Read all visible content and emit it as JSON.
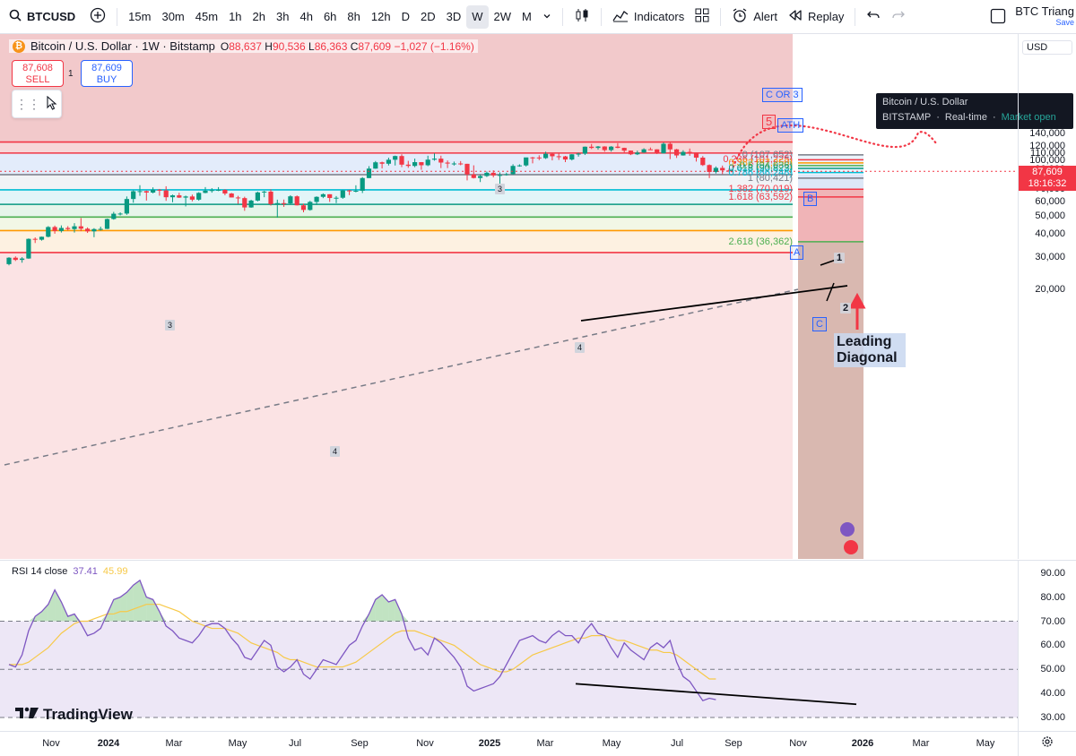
{
  "toolbar": {
    "symbol": "BTCUSD",
    "timeframes": [
      "15m",
      "30m",
      "45m",
      "1h",
      "2h",
      "3h",
      "4h",
      "6h",
      "8h",
      "12h",
      "D",
      "2D",
      "3D",
      "W",
      "2W",
      "M"
    ],
    "active_timeframe": "W",
    "indicators_label": "Indicators",
    "alert_label": "Alert",
    "replay_label": "Replay",
    "layout_name": "BTC Triang",
    "save_label": "Save"
  },
  "legend": {
    "title": "Bitcoin / U.S. Dollar · 1W · Bitstamp",
    "o_label": "O",
    "o": "88,637",
    "h_label": "H",
    "h": "90,536",
    "l_label": "L",
    "l": "86,363",
    "c_label": "C",
    "c": "87,609",
    "change": "−1,027 (−1.16%)"
  },
  "trade": {
    "sell_price": "87,608",
    "sell_label": "SELL",
    "buy_price": "87,609",
    "buy_label": "BUY",
    "spread": "1"
  },
  "tooltip": {
    "line1": "Bitcoin / U.S. Dollar",
    "exchange": "BITSTAMP",
    "session": "Real-time",
    "status": "Market open"
  },
  "price_axis": {
    "currency": "USD",
    "ticks": [
      "140,000",
      "120,000",
      "110,000",
      "100,000",
      "90,000",
      "80,000",
      "70,000",
      "60,000",
      "50,000",
      "40,000",
      "30,000",
      "20,000"
    ],
    "last_price": "87,609",
    "countdown": "18:16:32"
  },
  "rsi": {
    "label": "RSI 14 close",
    "value": "37.41",
    "ma_value": "45.99",
    "ticks": [
      "90.00",
      "80.00",
      "70.00",
      "60.00",
      "50.00",
      "40.00",
      "30.00"
    ]
  },
  "time_axis": {
    "labels": [
      "Nov",
      "2024",
      "Mar",
      "May",
      "Jul",
      "Sep",
      "Nov",
      "2025",
      "Mar",
      "May",
      "Jul",
      "Sep",
      "Nov",
      "2026",
      "Mar",
      "May"
    ]
  },
  "annotations": {
    "c_or_3": "C OR 3",
    "wave5": "5",
    "ath": "ATH",
    "b": "B",
    "a": "A",
    "c": "C",
    "w1": "1",
    "w2": "2",
    "w3_top": "3",
    "w3_left": "3",
    "w4_left": "4",
    "w4_mid": "4",
    "leading_line1": "Leading",
    "leading_line2": "Diagonal"
  },
  "fib_levels": [
    {
      "label": "0 (107,652)",
      "price": 107652,
      "color": "#787b86"
    },
    {
      "label": "0.236 (101,225)",
      "price": 101225,
      "color": "#f23645"
    },
    {
      "label": "0.382 (97,250)",
      "price": 97250,
      "color": "#ff9800"
    },
    {
      "label": "0.5 (94,036)",
      "price": 94036,
      "color": "#4caf50"
    },
    {
      "label": "0.618 (90,823)",
      "price": 90823,
      "color": "#089981"
    },
    {
      "label": "0.786 (86,248)",
      "price": 86248,
      "color": "#00bcd4"
    },
    {
      "label": "1 (80,421)",
      "price": 80421,
      "color": "#787b86"
    },
    {
      "label": "1.382 (70,019)",
      "price": 70019,
      "color": "#f23645"
    },
    {
      "label": "1.618 (63,592)",
      "price": 63592,
      "color": "#f23645"
    },
    {
      "label": "2.618 (36,362)",
      "price": 36362,
      "color": "#4caf50"
    }
  ],
  "horizontal_levels": [
    {
      "price": 126200,
      "color": "#f23645"
    },
    {
      "price": 110000,
      "color": "#f23645"
    },
    {
      "price": 84000,
      "color": "#787b86"
    },
    {
      "price": 69500,
      "color": "#00bcd4"
    },
    {
      "price": 58000,
      "color": "#089981"
    },
    {
      "price": 49500,
      "color": "#4caf50"
    },
    {
      "price": 41800,
      "color": "#ff9800"
    },
    {
      "price": 31800,
      "color": "#f23645"
    }
  ],
  "chart_data": {
    "type": "candlestick",
    "symbol": "Bitcoin / U.S. Dollar",
    "interval": "1W",
    "y_scale": "log",
    "ylim": [
      20000,
      145000
    ],
    "x": [
      "2023-10-23",
      "2023-10-30",
      "2023-11-06",
      "2023-11-13",
      "2023-11-20",
      "2023-11-27",
      "2023-12-04",
      "2023-12-11",
      "2023-12-18",
      "2023-12-25",
      "2024-01-01",
      "2024-01-08",
      "2024-01-15",
      "2024-01-22",
      "2024-01-29",
      "2024-02-05",
      "2024-02-12",
      "2024-02-19",
      "2024-02-26",
      "2024-03-04",
      "2024-03-11",
      "2024-03-18",
      "2024-03-25",
      "2024-04-01",
      "2024-04-08",
      "2024-04-15",
      "2024-04-22",
      "2024-04-29",
      "2024-05-06",
      "2024-05-13",
      "2024-05-20",
      "2024-05-27",
      "2024-06-03",
      "2024-06-10",
      "2024-06-17",
      "2024-06-24",
      "2024-07-01",
      "2024-07-08",
      "2024-07-15",
      "2024-07-22",
      "2024-07-29",
      "2024-08-05",
      "2024-08-12",
      "2024-08-19",
      "2024-08-26",
      "2024-09-02",
      "2024-09-09",
      "2024-09-16",
      "2024-09-23",
      "2024-09-30",
      "2024-10-07",
      "2024-10-14",
      "2024-10-21",
      "2024-10-28",
      "2024-11-04",
      "2024-11-11",
      "2024-11-18",
      "2024-11-25",
      "2024-12-02",
      "2024-12-09",
      "2024-12-16",
      "2024-12-23",
      "2024-12-30",
      "2025-01-06",
      "2025-01-13",
      "2025-01-20",
      "2025-01-27",
      "2025-02-03",
      "2025-02-10",
      "2025-02-17",
      "2025-02-24",
      "2025-03-03",
      "2025-03-10",
      "2025-03-17",
      "2025-03-24",
      "2025-03-31",
      "2025-04-07",
      "2025-04-14",
      "2025-04-21",
      "2025-04-28",
      "2025-05-05",
      "2025-05-12",
      "2025-05-19",
      "2025-05-26",
      "2025-06-02",
      "2025-06-09",
      "2025-06-16",
      "2025-06-23",
      "2025-06-30",
      "2025-07-07",
      "2025-07-14",
      "2025-07-21",
      "2025-07-28",
      "2025-08-04",
      "2025-08-11",
      "2025-08-18",
      "2025-08-25",
      "2025-09-01",
      "2025-09-08",
      "2025-09-15",
      "2025-09-22",
      "2025-09-29",
      "2025-10-06",
      "2025-10-13",
      "2025-10-20",
      "2025-10-27",
      "2025-11-03",
      "2025-11-10",
      "2025-11-17",
      "2025-11-24",
      "2025-12-01",
      "2025-12-08"
    ],
    "ohlc": [
      [
        27500,
        30000,
        27100,
        29800
      ],
      [
        29800,
        30300,
        28600,
        29000
      ],
      [
        29000,
        30000,
        28000,
        29500
      ],
      [
        29500,
        37900,
        29400,
        37700
      ],
      [
        37700,
        38400,
        35800,
        37300
      ],
      [
        37300,
        38800,
        36900,
        38700
      ],
      [
        38700,
        44200,
        38400,
        43700
      ],
      [
        43700,
        44500,
        40200,
        41600
      ],
      [
        41600,
        44600,
        40800,
        43200
      ],
      [
        43200,
        44200,
        41900,
        42600
      ],
      [
        42600,
        45900,
        40800,
        44100
      ],
      [
        44100,
        48900,
        41500,
        42800
      ],
      [
        42800,
        43500,
        40600,
        41400
      ],
      [
        41400,
        43100,
        38500,
        42600
      ],
      [
        42600,
        43900,
        41800,
        42700
      ],
      [
        42700,
        48600,
        42600,
        48300
      ],
      [
        48300,
        52800,
        47900,
        51600
      ],
      [
        51600,
        52500,
        50500,
        51700
      ],
      [
        51700,
        64000,
        50900,
        62000
      ],
      [
        62000,
        69100,
        59200,
        68300
      ],
      [
        68300,
        73700,
        64500,
        68400
      ],
      [
        68400,
        68900,
        60800,
        67200
      ],
      [
        67200,
        71700,
        66500,
        69600
      ],
      [
        69600,
        70300,
        64600,
        69000
      ],
      [
        69000,
        72700,
        60600,
        63400
      ],
      [
        63400,
        65500,
        59600,
        64900
      ],
      [
        64900,
        67000,
        62800,
        63100
      ],
      [
        63100,
        64700,
        56500,
        64000
      ],
      [
        64000,
        65500,
        60200,
        61500
      ],
      [
        61500,
        67500,
        60700,
        66900
      ],
      [
        66900,
        71900,
        66600,
        68800
      ],
      [
        68800,
        71000,
        67100,
        69300
      ],
      [
        69300,
        71900,
        68400,
        69500
      ],
      [
        69500,
        70000,
        65000,
        66400
      ],
      [
        66400,
        66900,
        63300,
        63200
      ],
      [
        63200,
        64500,
        58400,
        62700
      ],
      [
        62700,
        63800,
        53500,
        55800
      ],
      [
        55800,
        61400,
        55600,
        60800
      ],
      [
        60800,
        68000,
        60200,
        67300
      ],
      [
        67300,
        68700,
        63400,
        68000
      ],
      [
        68000,
        70000,
        57100,
        58200
      ],
      [
        58200,
        61500,
        49100,
        58900
      ],
      [
        58900,
        61600,
        56200,
        58700
      ],
      [
        58700,
        65000,
        58000,
        64100
      ],
      [
        64100,
        64800,
        57200,
        57300
      ],
      [
        57300,
        58500,
        52500,
        54100
      ],
      [
        54100,
        60600,
        53600,
        59800
      ],
      [
        59800,
        64100,
        57600,
        63700
      ],
      [
        63700,
        66500,
        62700,
        65800
      ],
      [
        65800,
        65800,
        59800,
        62800
      ],
      [
        62800,
        64300,
        58900,
        63000
      ],
      [
        63000,
        69400,
        62100,
        69000
      ],
      [
        69000,
        69500,
        65100,
        68400
      ],
      [
        68400,
        73600,
        67400,
        68700
      ],
      [
        68700,
        81500,
        66800,
        80500
      ],
      [
        80500,
        93400,
        80300,
        90600
      ],
      [
        90600,
        99600,
        90400,
        98000
      ],
      [
        98000,
        98800,
        90800,
        96300
      ],
      [
        96300,
        103900,
        94200,
        101200
      ],
      [
        101200,
        106600,
        94200,
        106000
      ],
      [
        106000,
        108400,
        92200,
        95200
      ],
      [
        95200,
        99800,
        91500,
        93700
      ],
      [
        93700,
        102700,
        92200,
        98200
      ],
      [
        98200,
        98300,
        89300,
        94500
      ],
      [
        94500,
        106400,
        93400,
        101300
      ],
      [
        101300,
        109600,
        100100,
        102600
      ],
      [
        102600,
        106500,
        91200,
        97700
      ],
      [
        97700,
        100300,
        91200,
        96500
      ],
      [
        96500,
        98900,
        94100,
        96600
      ],
      [
        96600,
        99500,
        94500,
        96200
      ],
      [
        96200,
        96200,
        78200,
        84300
      ],
      [
        84300,
        94400,
        80100,
        80600
      ],
      [
        80600,
        84200,
        76600,
        82600
      ],
      [
        82600,
        87400,
        81600,
        86000
      ],
      [
        86000,
        88700,
        81200,
        83200
      ],
      [
        83200,
        86400,
        74400,
        83700
      ],
      [
        83700,
        86100,
        83000,
        84500
      ],
      [
        84500,
        95700,
        83900,
        93700
      ],
      [
        93700,
        95600,
        92800,
        94300
      ],
      [
        94300,
        97900,
        93000,
        104200
      ],
      [
        104200,
        104900,
        96800,
        104100
      ],
      [
        104100,
        107000,
        100700,
        103300
      ],
      [
        103300,
        111900,
        102200,
        109000
      ],
      [
        109000,
        110400,
        100400,
        105700
      ],
      [
        105700,
        110500,
        101000,
        105500
      ],
      [
        105500,
        106200,
        98200,
        101500
      ],
      [
        101500,
        108500,
        100300,
        108300
      ],
      [
        108300,
        110500,
        105200,
        109200
      ],
      [
        109200,
        119400,
        107400,
        119100
      ],
      [
        119100,
        123200,
        115700,
        117300
      ],
      [
        117300,
        120200,
        114700,
        119400
      ],
      [
        119400,
        119800,
        111900,
        114200
      ],
      [
        114200,
        120000,
        112000,
        119200
      ],
      [
        119200,
        124500,
        116800,
        117400
      ],
      [
        117400,
        117600,
        110700,
        113400
      ],
      [
        113400,
        113600,
        107300,
        108300
      ],
      [
        108300,
        113400,
        107300,
        110700
      ],
      [
        110700,
        116800,
        110300,
        115300
      ],
      [
        115300,
        117900,
        114700,
        115200
      ],
      [
        115200,
        115400,
        108600,
        109600
      ],
      [
        109600,
        125700,
        109500,
        123500
      ],
      [
        123500,
        126200,
        102000,
        115200
      ],
      [
        115200,
        115900,
        103500,
        106800
      ],
      [
        106800,
        114000,
        106500,
        111600
      ],
      [
        111600,
        116400,
        106300,
        110600
      ],
      [
        110600,
        110600,
        98900,
        103900
      ],
      [
        103900,
        106000,
        93600,
        94700
      ],
      [
        94700,
        95500,
        80500,
        86900
      ],
      [
        86900,
        93100,
        85200,
        91400
      ],
      [
        91400,
        94100,
        84600,
        88600
      ],
      [
        88600,
        90536,
        86363,
        87609
      ]
    ],
    "projection_peak": 142000,
    "rsi": {
      "period": 14,
      "values": [
        52,
        51,
        56,
        66,
        72,
        74,
        77,
        83,
        78,
        72,
        73,
        69,
        64,
        65,
        67,
        73,
        79,
        80,
        82,
        85,
        87,
        80,
        79,
        74,
        68,
        66,
        63,
        62,
        61,
        64,
        68,
        69,
        69,
        67,
        63,
        60,
        55,
        54,
        58,
        62,
        60,
        51,
        49,
        51,
        54,
        48,
        46,
        50,
        54,
        53,
        52,
        56,
        60,
        62,
        68,
        73,
        79,
        81,
        78,
        79,
        73,
        63,
        58,
        59,
        56,
        63,
        61,
        58,
        55,
        51,
        43,
        41,
        42,
        43,
        44,
        47,
        52,
        57,
        62,
        63,
        64,
        62,
        61,
        64,
        66,
        64,
        64,
        61,
        66,
        69,
        65,
        64,
        59,
        55,
        61,
        58,
        56,
        54,
        59,
        61,
        59,
        62,
        53,
        47,
        45,
        41,
        37,
        38,
        37.41
      ],
      "ma": [
        52,
        52,
        52,
        53,
        55,
        57,
        59,
        62,
        65,
        67,
        69,
        70,
        70,
        71,
        72,
        73,
        73,
        74,
        74,
        75,
        76,
        77,
        77,
        77,
        76,
        75,
        74,
        72,
        70,
        69,
        68,
        67,
        67,
        67,
        66,
        65,
        63,
        61,
        60,
        59,
        58,
        57,
        55,
        54,
        54,
        53,
        52,
        51,
        51,
        51,
        51,
        51,
        52,
        53,
        55,
        57,
        59,
        61,
        63,
        65,
        66,
        66,
        66,
        65,
        64,
        63,
        62,
        61,
        60,
        58,
        56,
        54,
        52,
        51,
        50,
        49,
        49,
        50,
        52,
        54,
        56,
        57,
        58,
        59,
        60,
        61,
        62,
        63,
        63,
        64,
        64,
        64,
        63,
        62,
        62,
        61,
        60,
        59,
        58,
        58,
        57,
        57,
        56,
        54,
        52,
        50,
        48,
        46,
        45.99
      ]
    }
  }
}
